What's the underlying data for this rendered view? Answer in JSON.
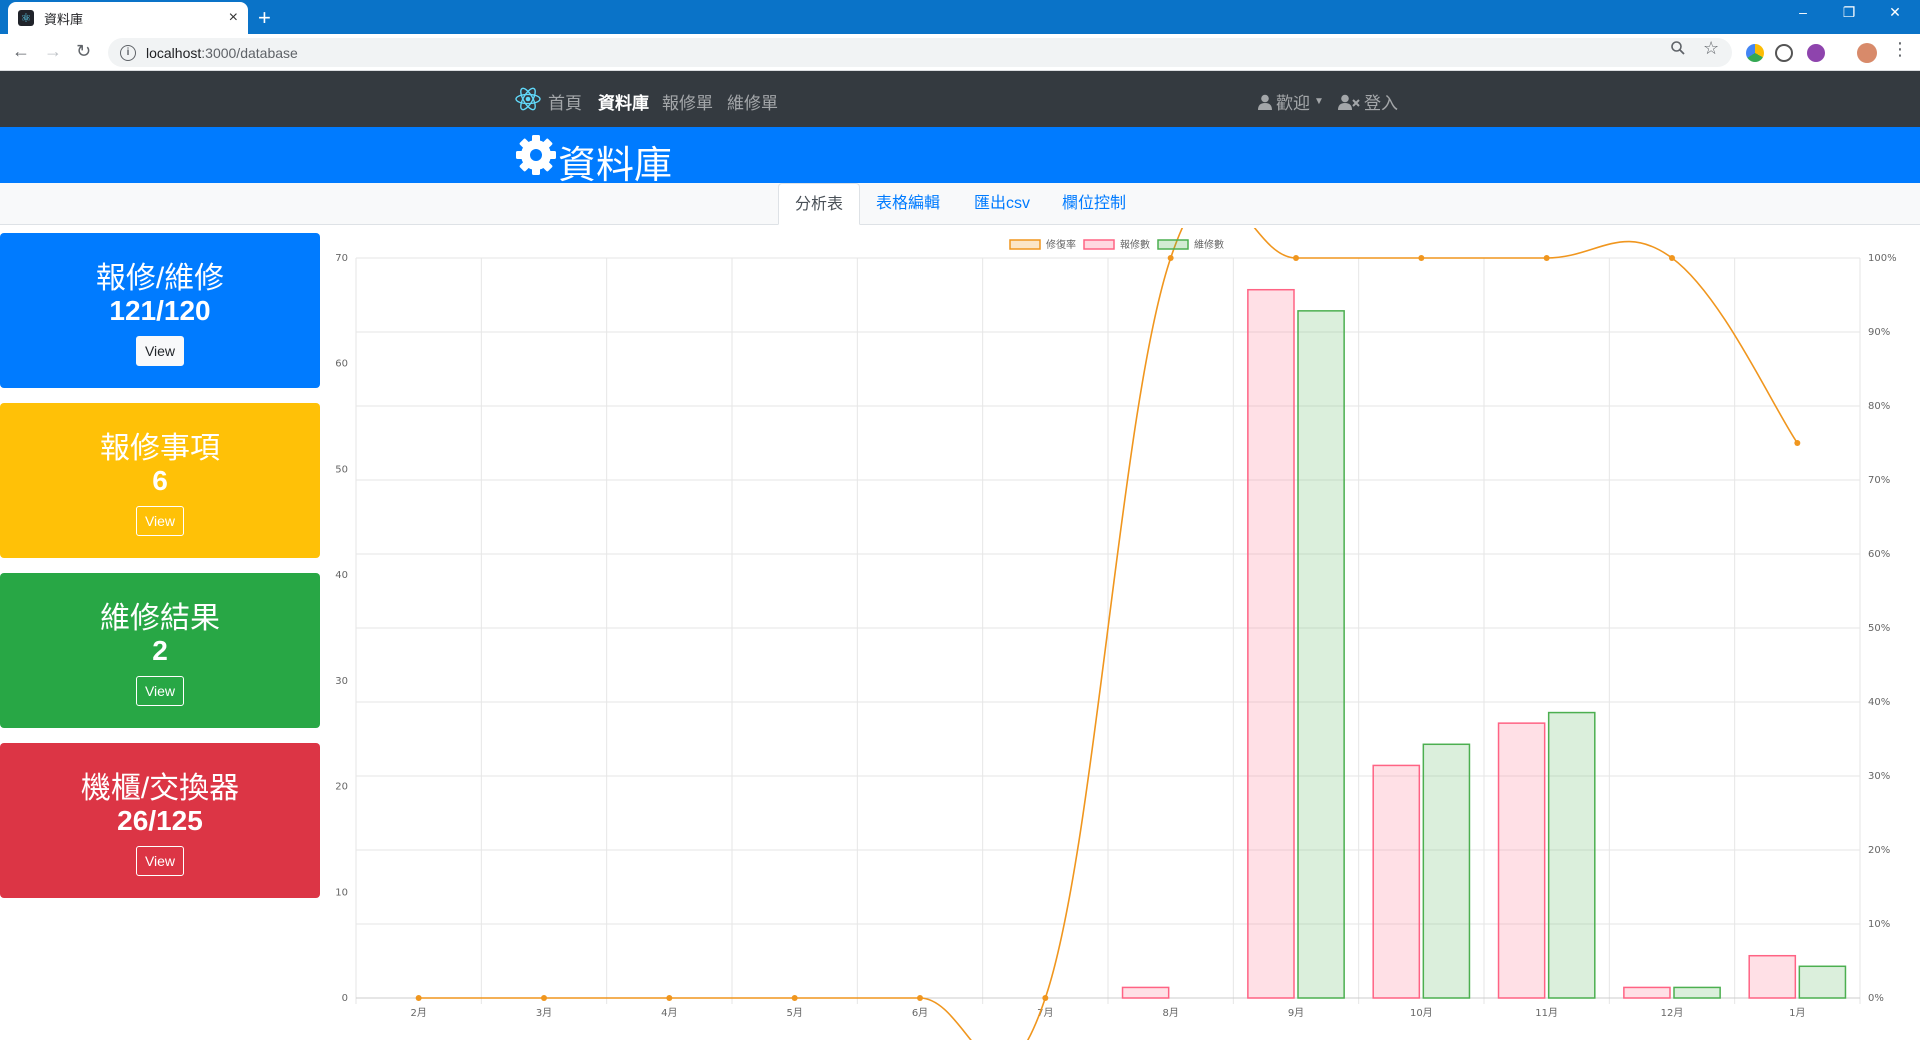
{
  "browser": {
    "tab_title": "資料庫",
    "tab_close": "×",
    "new_tab": "+",
    "url_host": "localhost",
    "url_path": ":3000/database",
    "window_controls": [
      "–",
      "❐",
      "✕"
    ]
  },
  "navbar": {
    "items": [
      {
        "label": "首頁",
        "active": false
      },
      {
        "label": "資料庫",
        "active": true
      },
      {
        "label": "報修單",
        "active": false
      },
      {
        "label": "維修單",
        "active": false
      }
    ],
    "welcome": "歡迎",
    "login": "登入"
  },
  "header": {
    "title": "資料庫",
    "icon": "gear-icon"
  },
  "tabs": [
    {
      "label": "分析表",
      "active": true
    },
    {
      "label": "表格編輯",
      "active": false
    },
    {
      "label": "匯出csv",
      "active": false
    },
    {
      "label": "欄位控制",
      "active": false
    }
  ],
  "cards": [
    {
      "title": "報修/維修",
      "value": "121/120",
      "button": "View",
      "color": "#007bff",
      "button_style": "light"
    },
    {
      "title": "報修事項",
      "value": "6",
      "button": "View",
      "color": "#ffc107",
      "button_style": "outline"
    },
    {
      "title": "維修結果",
      "value": "2",
      "button": "View",
      "color": "#28a745",
      "button_style": "outline"
    },
    {
      "title": "機櫃/交換器",
      "value": "26/125",
      "button": "View",
      "color": "#dc3545",
      "button_style": "outline"
    }
  ],
  "chart_data": {
    "type": "bar",
    "categories": [
      "2月",
      "3月",
      "4月",
      "5月",
      "6月",
      "7月",
      "8月",
      "9月",
      "10月",
      "11月",
      "12月",
      "1月"
    ],
    "series": [
      {
        "name": "修復率",
        "type": "line",
        "axis": "right",
        "color": "#f0961e",
        "values": [
          0,
          0,
          0,
          0,
          0,
          0,
          100,
          100,
          100,
          100,
          100,
          75
        ]
      },
      {
        "name": "報修數",
        "type": "bar",
        "axis": "left",
        "color": "#ff6384",
        "values": [
          0,
          0,
          0,
          0,
          0,
          0,
          1,
          67,
          22,
          26,
          1,
          4
        ]
      },
      {
        "name": "維修數",
        "type": "bar",
        "axis": "left",
        "color": "#4caf50",
        "values": [
          0,
          0,
          0,
          0,
          0,
          0,
          0,
          65,
          24,
          27,
          1,
          3
        ]
      }
    ],
    "ylim": [
      0,
      70
    ],
    "y_ticks": [
      "0",
      "10",
      "20",
      "30",
      "40",
      "50",
      "60",
      "70"
    ],
    "y2lim": [
      0,
      100
    ],
    "y2_ticks": [
      "0%",
      "10%",
      "20%",
      "30%",
      "40%",
      "50%",
      "60%",
      "70%",
      "80%",
      "90%",
      "100%"
    ],
    "legend": "top-center",
    "grid": true
  }
}
